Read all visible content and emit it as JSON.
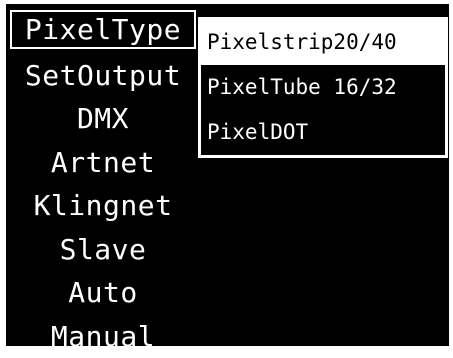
{
  "menu": {
    "items": [
      {
        "label": "PixelType"
      },
      {
        "label": "SetOutput"
      },
      {
        "label": "DMX"
      },
      {
        "label": "Artnet"
      },
      {
        "label": "Klingnet"
      },
      {
        "label": "Slave"
      },
      {
        "label": "Auto"
      },
      {
        "label": "Manual"
      }
    ],
    "selected_index": 0
  },
  "submenu": {
    "items": [
      {
        "label": "Pixelstrip20/40"
      },
      {
        "label": "PixelTube 16/32"
      },
      {
        "label": "PixelDOT"
      }
    ]
  },
  "colors": {
    "screen_background": "#000000",
    "foreground": "#ffffff"
  }
}
